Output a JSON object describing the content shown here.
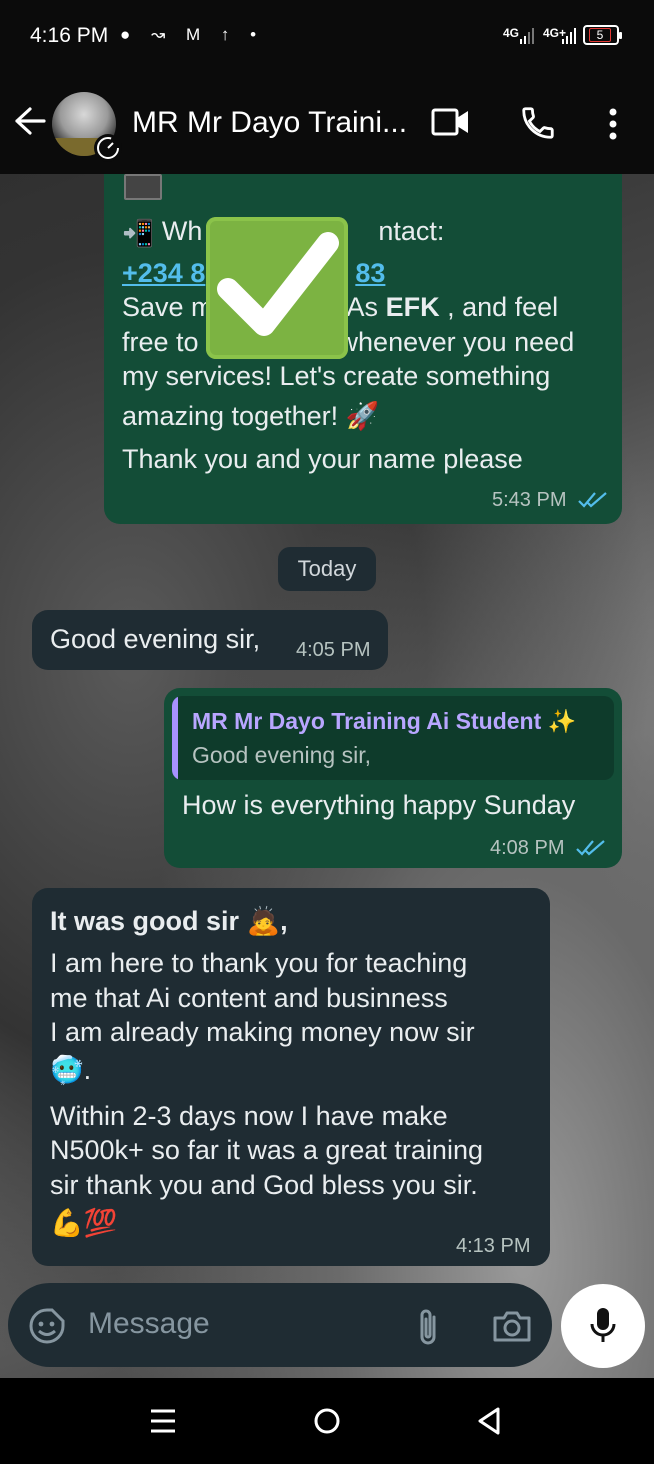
{
  "status_bar": {
    "time": "4:16 PM",
    "notification_icons": "● ↝ M ↑ •",
    "network1": "4G",
    "network2": "4G+",
    "battery": "5"
  },
  "header": {
    "title": "MR Mr Dayo Traini...",
    "icons": [
      "back-arrow-icon",
      "video-call-icon",
      "phone-icon",
      "more-vert-icon"
    ]
  },
  "messages": {
    "m1": {
      "line1_prefix": "Wh",
      "line1_suffix": "ntact:",
      "line2_a": "+234 8",
      "line2_b": "83",
      "line3_a": "Save m",
      "line3_b": "As ",
      "line3_bold": "EFK",
      "line3_c": " , and feel",
      "line4_a": "free to",
      "line4_b": "whenever you need",
      "line5": "my services! Let's create something",
      "line6": "amazing together! 🚀",
      "line7": "Thank you and your name please",
      "time": "5:43 PM"
    },
    "date_chip": "Today",
    "m2": {
      "text": "Good evening sir,",
      "time": "4:05 PM"
    },
    "m3": {
      "quote_name": "MR Mr Dayo Training Ai Student ✨",
      "quote_text": "Good evening sir,",
      "text": "How is everything happy Sunday",
      "time": "4:08 PM"
    },
    "m4": {
      "bold_line": "It was good sir 🙇,",
      "line2": "I am here to thank you for teaching",
      "line3": "me that Ai content and businness",
      "line4": "I am already making money now sir",
      "line5": "🥶.",
      "line6": "Within 2-3 days now I have make",
      "line7": "N500k+ so far it was a great training",
      "line8": "sir thank you and God bless you sir.",
      "line9": "💪💯",
      "time": "4:13 PM"
    }
  },
  "input": {
    "placeholder": "Message"
  },
  "colors": {
    "outgoing_bubble": "#134d37",
    "incoming_bubble": "#1f2c33",
    "read_ticks": "#53bdeb"
  }
}
